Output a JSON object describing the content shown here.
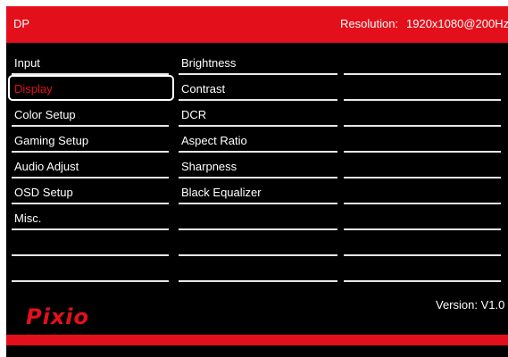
{
  "header": {
    "input": "DP",
    "resolution_label": "Resolution:",
    "resolution_value": "1920x1080@200Hz"
  },
  "menu": {
    "main": [
      "Input",
      "Display",
      "Color Setup",
      "Gaming Setup",
      "Audio Adjust",
      "OSD Setup",
      "Misc.",
      "",
      ""
    ],
    "selected_main": "Display",
    "sub": [
      "Brightness",
      "Contrast",
      "DCR",
      "Aspect Ratio",
      "Sharpness",
      "Black Equalizer",
      "",
      "",
      ""
    ],
    "values": [
      "",
      "",
      "",
      "",
      "",
      "",
      "",
      "",
      ""
    ]
  },
  "footer": {
    "version": "Version: V1.0",
    "logo": "Pixio"
  },
  "colors": {
    "accent": "#e3101b",
    "background": "#000000",
    "text": "#ffffff"
  }
}
